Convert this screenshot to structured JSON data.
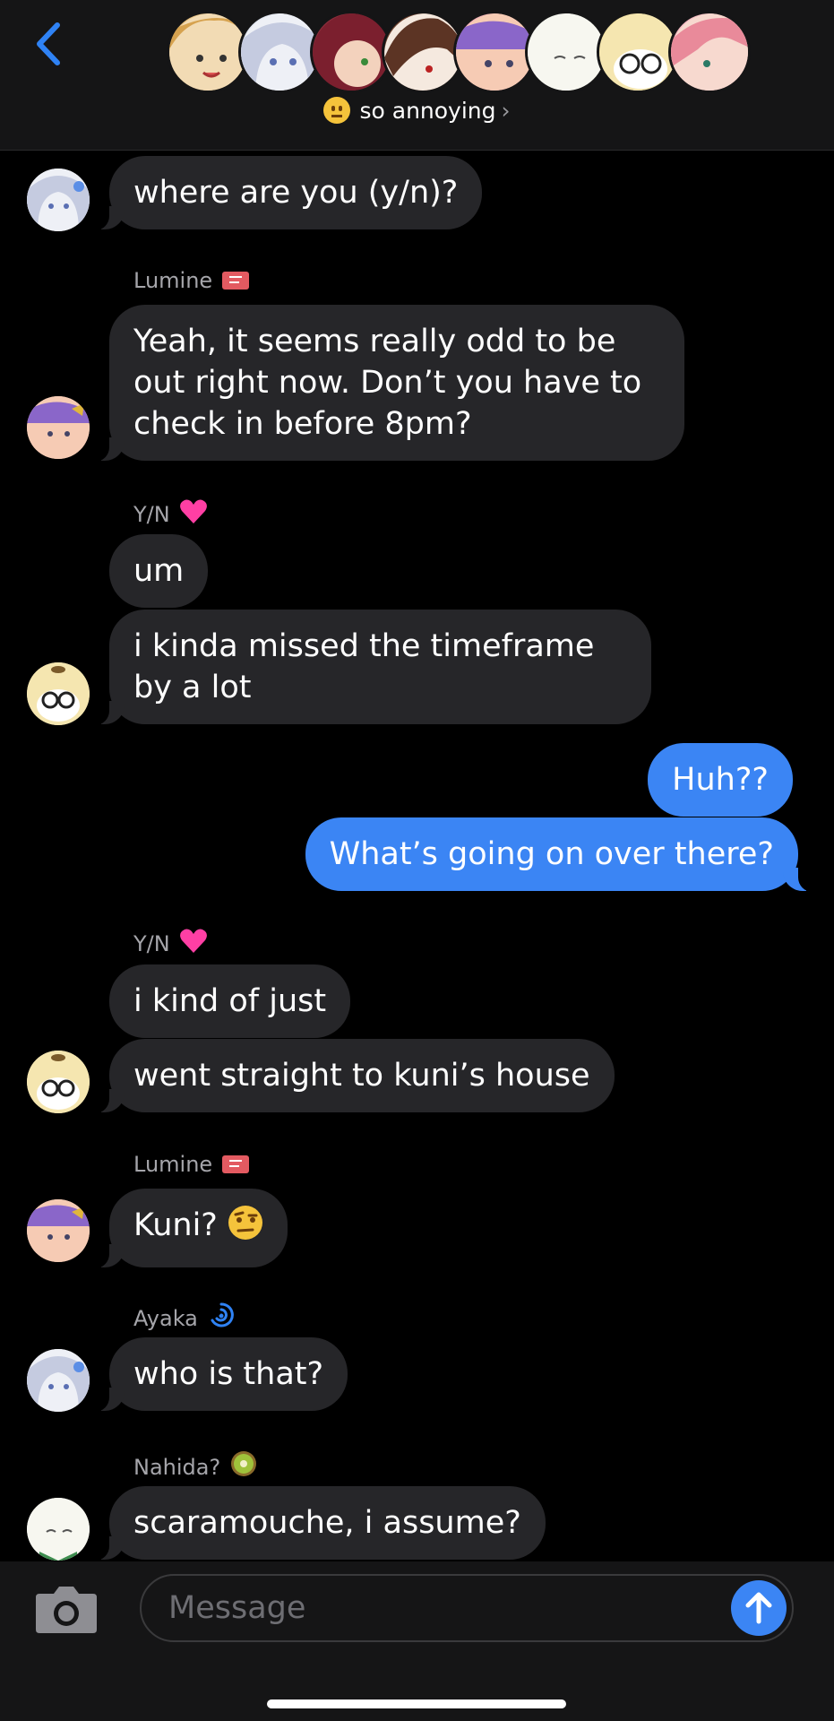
{
  "header": {
    "group_name": "so annoying",
    "chevron": "›",
    "back_icon": "chevron-left-icon",
    "group_emoji": "neutral-face-icon"
  },
  "colors": {
    "accent": "#3b85f4",
    "bubble_incoming": "#262629",
    "background": "#000000",
    "header_bg": "#151516"
  },
  "messages": [
    {
      "text": "where are you (y/n)?"
    },
    {
      "sender": "Lumine",
      "text": "Yeah, it seems really odd to be out right now. Don’t you have to check in before 8pm?"
    },
    {
      "sender": "Y/N",
      "text": "um"
    },
    {
      "text": "i kinda missed the timeframe by a lot"
    },
    {
      "text": "Huh??"
    },
    {
      "text": "What’s going on over there?"
    },
    {
      "sender": "Y/N",
      "text": "i kind of just"
    },
    {
      "text": "went straight to kuni’s house"
    },
    {
      "sender": "Lumine",
      "text": "Kuni?"
    },
    {
      "sender": "Ayaka",
      "text": "who is that?"
    },
    {
      "sender": "Nahida?",
      "text": "scaramouche, i assume?"
    }
  ],
  "composer": {
    "placeholder": "Message",
    "camera_icon": "camera-icon",
    "send_icon": "arrow-up-icon"
  }
}
